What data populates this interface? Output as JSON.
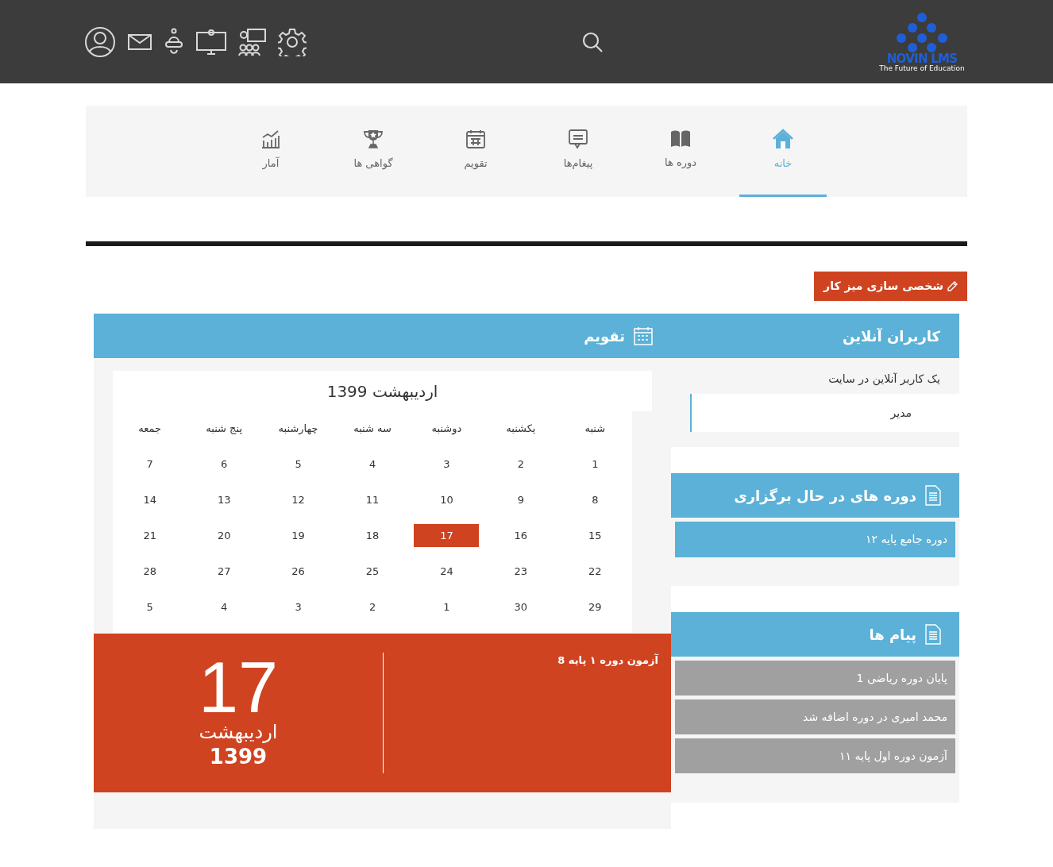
{
  "header": {
    "logo": {
      "name": "NOVIN LMS",
      "tagline": "The Future of Education"
    },
    "icons": [
      {
        "kind": "user"
      },
      {
        "kind": "mail"
      },
      {
        "kind": "bell"
      },
      {
        "kind": "monitor"
      },
      {
        "kind": "class"
      },
      {
        "kind": "settings"
      }
    ]
  },
  "nav_tabs": [
    {
      "label": "خانه",
      "kind": "home",
      "selected": true
    },
    {
      "label": "دوره ها",
      "kind": "book",
      "selected": false
    },
    {
      "label": "پیغام‌ها",
      "kind": "chat",
      "selected": false
    },
    {
      "label": "تقویم",
      "kind": "calendar",
      "selected": false
    },
    {
      "label": "گواهی ها",
      "kind": "trophy",
      "selected": false
    },
    {
      "label": "آمار",
      "kind": "chart",
      "selected": false
    }
  ],
  "customize_button": "شخصی سازی میز کار",
  "online_users": {
    "title": "کاربران آنلاین",
    "summary": "یک کاربر آنلاین در سایت",
    "users": [
      "مدیر"
    ]
  },
  "calendar": {
    "title": "تقویم",
    "month_title": "اردیبهشت 1399",
    "weekdays": [
      "شنبه",
      "یکشنبه",
      "دوشنبه",
      "سه شنبه",
      "چهارشنبه",
      "پنج شنبه",
      "جمعه"
    ],
    "weeks": [
      [
        {
          "day": "1",
          "selected": false
        },
        {
          "day": "2",
          "selected": false
        },
        {
          "day": "3",
          "selected": false
        },
        {
          "day": "4",
          "selected": false
        },
        {
          "day": "5",
          "selected": false
        },
        {
          "day": "6",
          "selected": false
        },
        {
          "day": "7",
          "selected": false
        }
      ],
      [
        {
          "day": "8",
          "selected": false
        },
        {
          "day": "9",
          "selected": false
        },
        {
          "day": "10",
          "selected": false
        },
        {
          "day": "11",
          "selected": false
        },
        {
          "day": "12",
          "selected": false
        },
        {
          "day": "13",
          "selected": false
        },
        {
          "day": "14",
          "selected": false
        }
      ],
      [
        {
          "day": "15",
          "selected": false
        },
        {
          "day": "16",
          "selected": false
        },
        {
          "day": "17",
          "selected": true
        },
        {
          "day": "18",
          "selected": false
        },
        {
          "day": "19",
          "selected": false
        },
        {
          "day": "20",
          "selected": false
        },
        {
          "day": "21",
          "selected": false
        }
      ],
      [
        {
          "day": "22",
          "selected": false
        },
        {
          "day": "23",
          "selected": false
        },
        {
          "day": "24",
          "selected": false
        },
        {
          "day": "25",
          "selected": false
        },
        {
          "day": "26",
          "selected": false
        },
        {
          "day": "27",
          "selected": false
        },
        {
          "day": "28",
          "selected": false
        }
      ],
      [
        {
          "day": "29",
          "selected": false
        },
        {
          "day": "30",
          "selected": false
        },
        {
          "day": "1",
          "selected": false
        },
        {
          "day": "2",
          "selected": false
        },
        {
          "day": "3",
          "selected": false
        },
        {
          "day": "4",
          "selected": false
        },
        {
          "day": "5",
          "selected": false
        }
      ]
    ],
    "selected_day": {
      "day": "17",
      "month": "اردیبهشت",
      "year": "1399"
    },
    "events": [
      "آزمون دوره ۱ پایه 8"
    ]
  },
  "active_courses": {
    "title": "دوره های در حال برگزاری",
    "items": [
      "دوره جامع پایه ۱۲"
    ]
  },
  "messages": {
    "title": "پیام ها",
    "items": [
      "پایان دوره ریاضی 1",
      "محمد امیری در دوره اضافه شد",
      "آزمون دوره اول پایه ۱۱"
    ]
  }
}
